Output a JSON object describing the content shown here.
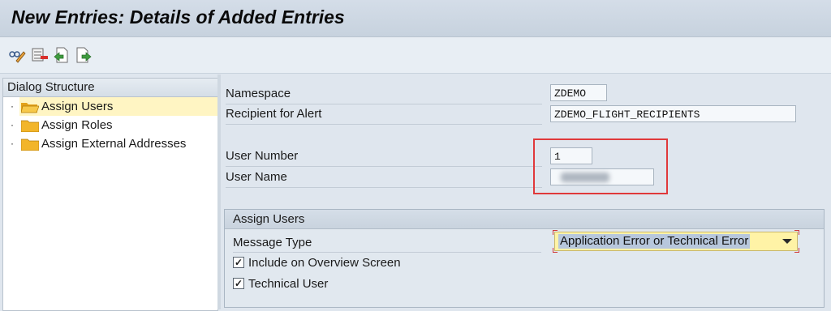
{
  "title": "New Entries: Details of Added Entries",
  "toolbar": {
    "buttons": [
      {
        "icon": "display-change-icon"
      },
      {
        "icon": "delete-row-icon"
      },
      {
        "icon": "previous-entry-icon"
      },
      {
        "icon": "next-entry-icon"
      }
    ]
  },
  "dialog_structure": {
    "header": "Dialog Structure",
    "items": [
      {
        "label": "Assign Users",
        "selected": true,
        "open": true
      },
      {
        "label": "Assign Roles",
        "selected": false,
        "open": false
      },
      {
        "label": "Assign External Addresses",
        "selected": false,
        "open": false
      }
    ]
  },
  "form": {
    "namespace_label": "Namespace",
    "namespace_value": "ZDEMO",
    "recipient_label": "Recipient for Alert",
    "recipient_value": "ZDEMO_FLIGHT_RECIPIENTS",
    "user_number_label": "User Number",
    "user_number_value": "1",
    "user_name_label": "User Name"
  },
  "assign_users": {
    "header": "Assign Users",
    "message_type_label": "Message Type",
    "message_type_value": "Application Error or Technical Error",
    "include_overview_label": "Include on Overview Screen",
    "include_overview_checked": true,
    "technical_user_label": "Technical User",
    "technical_user_checked": true
  },
  "colors": {
    "highlight_box": "#e0393b",
    "selected_row": "#fff5c3",
    "dropdown_bg": "#fff3a6"
  }
}
